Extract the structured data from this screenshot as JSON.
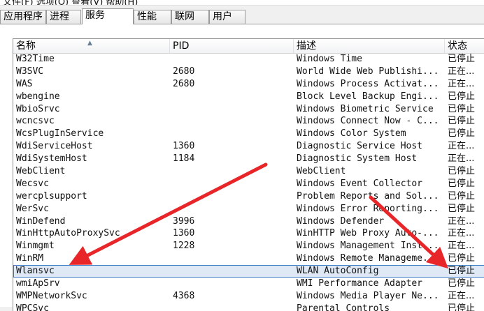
{
  "menubar": {
    "text": "文件(F)  选项(O)  查看(V)  帮助(H)"
  },
  "tabs": [
    {
      "label": "应用程序",
      "active": false
    },
    {
      "label": "进程",
      "active": false
    },
    {
      "label": "服务",
      "active": true
    },
    {
      "label": "性能",
      "active": false
    },
    {
      "label": "联网",
      "active": false
    },
    {
      "label": "用户",
      "active": false
    }
  ],
  "columns": {
    "name": "名称",
    "pid": "PID",
    "desc": "描述",
    "status": "状态"
  },
  "rows": [
    {
      "name": "W32Time",
      "pid": "",
      "desc": "Windows Time",
      "status": "已停止"
    },
    {
      "name": "W3SVC",
      "pid": "2680",
      "desc": "World Wide Web Publishi...",
      "status": "正在..."
    },
    {
      "name": "WAS",
      "pid": "2680",
      "desc": "Windows Process Activat...",
      "status": "正在..."
    },
    {
      "name": "wbengine",
      "pid": "",
      "desc": "Block Level Backup Engi...",
      "status": "已停止"
    },
    {
      "name": "WbioSrvc",
      "pid": "",
      "desc": "Windows Biometric Service",
      "status": "已停止"
    },
    {
      "name": "wcncsvc",
      "pid": "",
      "desc": "Windows Connect Now - C...",
      "status": "已停止"
    },
    {
      "name": "WcsPlugInService",
      "pid": "",
      "desc": "Windows Color System",
      "status": "已停止"
    },
    {
      "name": "WdiServiceHost",
      "pid": "1360",
      "desc": "Diagnostic Service Host",
      "status": "正在..."
    },
    {
      "name": "WdiSystemHost",
      "pid": "1184",
      "desc": "Diagnostic System Host",
      "status": "正在..."
    },
    {
      "name": "WebClient",
      "pid": "",
      "desc": "WebClient",
      "status": "已停止"
    },
    {
      "name": "Wecsvc",
      "pid": "",
      "desc": "Windows Event Collector",
      "status": "已停止"
    },
    {
      "name": "wercplsupport",
      "pid": "",
      "desc": "Problem Reports and Sol...",
      "status": "已停止"
    },
    {
      "name": "WerSvc",
      "pid": "",
      "desc": "Windows Error Reporting...",
      "status": "已停止"
    },
    {
      "name": "WinDefend",
      "pid": "3996",
      "desc": "Windows Defender",
      "status": "正在..."
    },
    {
      "name": "WinHttpAutoProxySvc",
      "pid": "1360",
      "desc": "WinHTTP Web Proxy Auto-...",
      "status": "正在..."
    },
    {
      "name": "Winmgmt",
      "pid": "1228",
      "desc": "Windows Management Inst...",
      "status": "正在..."
    },
    {
      "name": "WinRM",
      "pid": "",
      "desc": "Windows Remote Manageme...",
      "status": "已停止"
    },
    {
      "name": "Wlansvc",
      "pid": "",
      "desc": "WLAN AutoConfig",
      "status": "已停止",
      "selected": true
    },
    {
      "name": "wmiApSrv",
      "pid": "",
      "desc": "WMI Performance Adapter",
      "status": "已停止"
    },
    {
      "name": "WMPNetworkSvc",
      "pid": "4368",
      "desc": "Windows Media Player Ne...",
      "status": "正在..."
    },
    {
      "name": "WPCSvc",
      "pid": "",
      "desc": "Parental Controls",
      "status": "已停止"
    }
  ],
  "colors": {
    "arrow": "#e8262a",
    "selection": "#dfe8f5",
    "selection_border": "#3d79c4"
  }
}
